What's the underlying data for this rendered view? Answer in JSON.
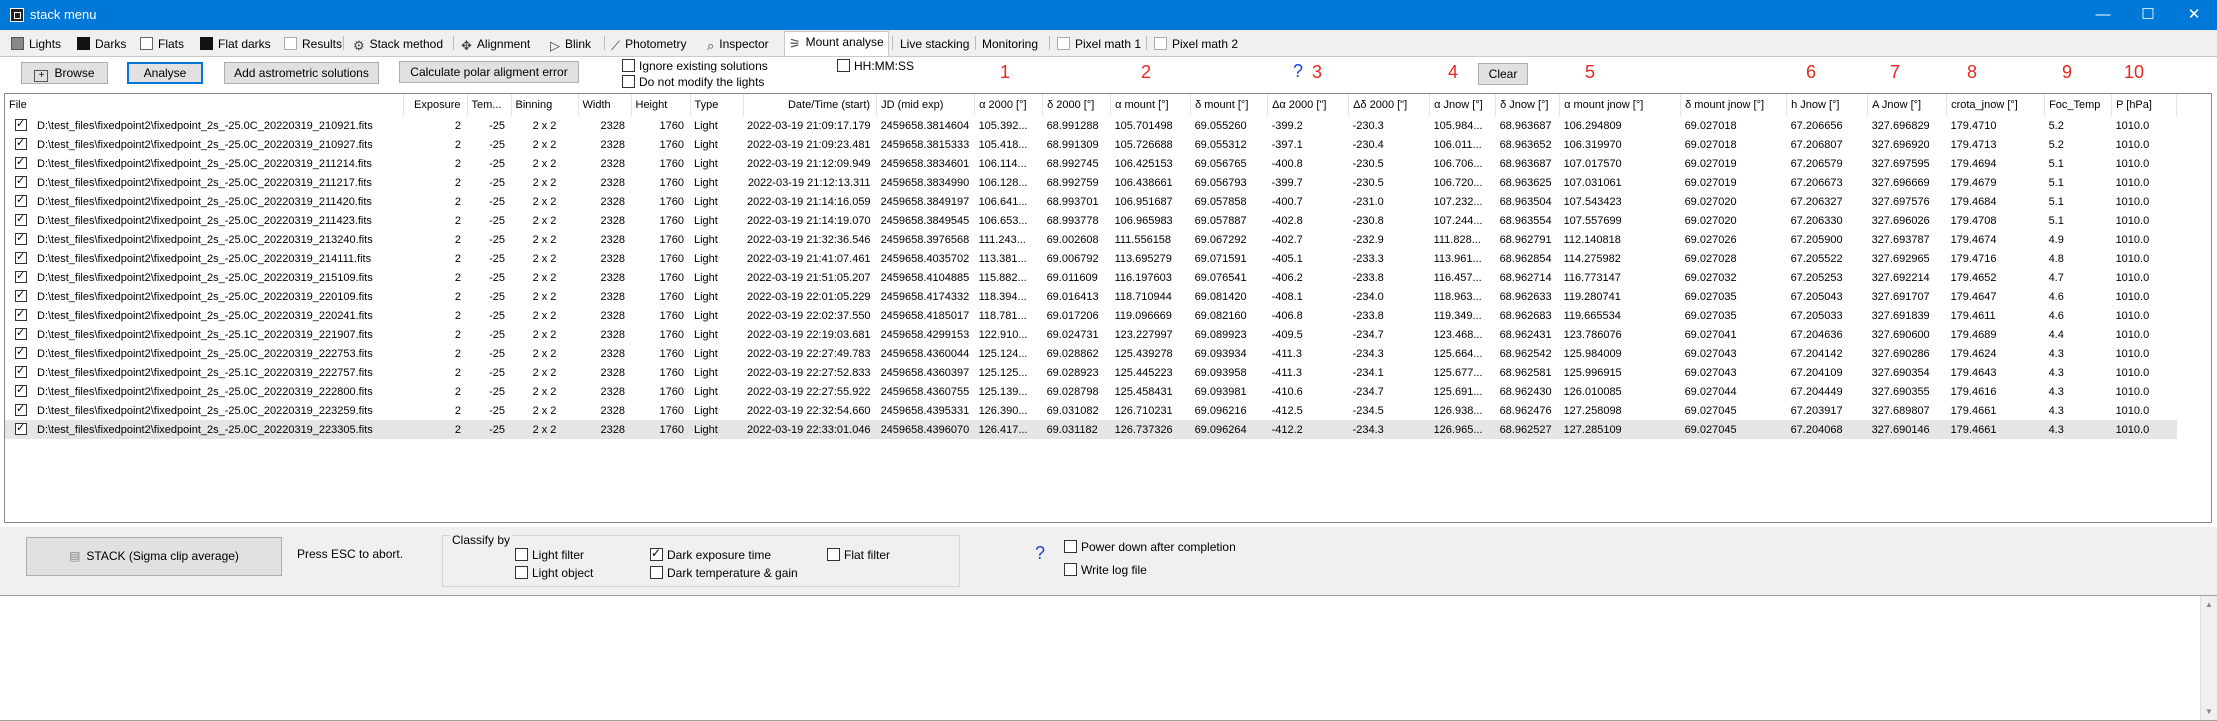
{
  "window": {
    "title": "stack menu",
    "minimize": "—",
    "maximize": "☐",
    "close": "✕"
  },
  "tabs": [
    {
      "label": "Lights",
      "icon": "lights-icon"
    },
    {
      "label": "Darks",
      "icon": "darks-icon"
    },
    {
      "label": "Flats",
      "icon": "flats-icon"
    },
    {
      "label": "Flat darks",
      "icon": "flat-darks-icon"
    },
    {
      "label": "Results",
      "icon": "results-icon"
    },
    {
      "label": "Stack method",
      "icon": "stack-method-icon"
    },
    {
      "label": "Alignment",
      "icon": "alignment-icon"
    },
    {
      "label": "Blink",
      "icon": "blink-icon"
    },
    {
      "label": "Photometry",
      "icon": "photometry-icon"
    },
    {
      "label": "Inspector",
      "icon": "inspector-icon"
    },
    {
      "label": "Mount analyse",
      "icon": "mount-analyse-icon"
    },
    {
      "label": "Live stacking",
      "icon": ""
    },
    {
      "label": "Monitoring",
      "icon": ""
    },
    {
      "label": "Pixel math 1",
      "icon": "pixel-math-icon"
    },
    {
      "label": "Pixel math 2",
      "icon": "pixel-math-icon"
    }
  ],
  "toolbar": {
    "browse": "Browse",
    "analyse": "Analyse",
    "add_astrometric": "Add astrometric solutions",
    "calc_polar": "Calculate polar aligment error",
    "ignore_existing": "Ignore existing solutions",
    "do_not_modify": "Do not modify the lights",
    "hhmmss": "HH:MM:SS",
    "clear": "Clear",
    "help_q": "?"
  },
  "annotations": [
    "1",
    "2",
    "3",
    "4",
    "5",
    "6",
    "7",
    "8",
    "9",
    "10"
  ],
  "table": {
    "headers": [
      "File",
      "Exposure",
      "Tem...",
      "Binning",
      "Width",
      "Height",
      "Type",
      "Date/Time (start)",
      "JD (mid exp)",
      "α 2000 [°]",
      "δ 2000 [°]",
      "α mount [°]",
      "δ mount [°]",
      "Δα 2000 [\"]",
      "Δδ 2000 [\"]",
      "α Jnow [°]",
      "δ Jnow [°]",
      "α mount jnow [°]",
      "δ mount jnow [°]",
      "h Jnow [°]",
      "A Jnow [°]",
      "crota_jnow [°]",
      "Foc_Temp",
      "P [hPa]"
    ],
    "rows": [
      [
        "D:\\test_files\\fixedpoint2\\fixedpoint_2s_-25.0C_20220319_210921.fits",
        "2",
        "-25",
        "2 x 2",
        "2328",
        "1760",
        "Light",
        "2022-03-19 21:09:17.179",
        "2459658.3814604",
        "105.392...",
        "68.991288",
        "105.701498",
        "69.055260",
        "-399.2",
        "-230.3",
        "105.984...",
        "68.963687",
        "106.294809",
        "69.027018",
        "67.206656",
        "327.696829",
        "179.4710",
        "5.2",
        "1010.0"
      ],
      [
        "D:\\test_files\\fixedpoint2\\fixedpoint_2s_-25.0C_20220319_210927.fits",
        "2",
        "-25",
        "2 x 2",
        "2328",
        "1760",
        "Light",
        "2022-03-19 21:09:23.481",
        "2459658.3815333",
        "105.418...",
        "68.991309",
        "105.726688",
        "69.055312",
        "-397.1",
        "-230.4",
        "106.011...",
        "68.963652",
        "106.319970",
        "69.027018",
        "67.206807",
        "327.696920",
        "179.4713",
        "5.2",
        "1010.0"
      ],
      [
        "D:\\test_files\\fixedpoint2\\fixedpoint_2s_-25.0C_20220319_211214.fits",
        "2",
        "-25",
        "2 x 2",
        "2328",
        "1760",
        "Light",
        "2022-03-19 21:12:09.949",
        "2459658.3834601",
        "106.114...",
        "68.992745",
        "106.425153",
        "69.056765",
        "-400.8",
        "-230.5",
        "106.706...",
        "68.963687",
        "107.017570",
        "69.027019",
        "67.206579",
        "327.697595",
        "179.4694",
        "5.1",
        "1010.0"
      ],
      [
        "D:\\test_files\\fixedpoint2\\fixedpoint_2s_-25.0C_20220319_211217.fits",
        "2",
        "-25",
        "2 x 2",
        "2328",
        "1760",
        "Light",
        "2022-03-19 21:12:13.311",
        "2459658.3834990",
        "106.128...",
        "68.992759",
        "106.438661",
        "69.056793",
        "-399.7",
        "-230.5",
        "106.720...",
        "68.963625",
        "107.031061",
        "69.027019",
        "67.206673",
        "327.696669",
        "179.4679",
        "5.1",
        "1010.0"
      ],
      [
        "D:\\test_files\\fixedpoint2\\fixedpoint_2s_-25.0C_20220319_211420.fits",
        "2",
        "-25",
        "2 x 2",
        "2328",
        "1760",
        "Light",
        "2022-03-19 21:14:16.059",
        "2459658.3849197",
        "106.641...",
        "68.993701",
        "106.951687",
        "69.057858",
        "-400.7",
        "-231.0",
        "107.232...",
        "68.963504",
        "107.543423",
        "69.027020",
        "67.206327",
        "327.697576",
        "179.4684",
        "5.1",
        "1010.0"
      ],
      [
        "D:\\test_files\\fixedpoint2\\fixedpoint_2s_-25.0C_20220319_211423.fits",
        "2",
        "-25",
        "2 x 2",
        "2328",
        "1760",
        "Light",
        "2022-03-19 21:14:19.070",
        "2459658.3849545",
        "106.653...",
        "68.993778",
        "106.965983",
        "69.057887",
        "-402.8",
        "-230.8",
        "107.244...",
        "68.963554",
        "107.557699",
        "69.027020",
        "67.206330",
        "327.696026",
        "179.4708",
        "5.1",
        "1010.0"
      ],
      [
        "D:\\test_files\\fixedpoint2\\fixedpoint_2s_-25.0C_20220319_213240.fits",
        "2",
        "-25",
        "2 x 2",
        "2328",
        "1760",
        "Light",
        "2022-03-19 21:32:36.546",
        "2459658.3976568",
        "111.243...",
        "69.002608",
        "111.556158",
        "69.067292",
        "-402.7",
        "-232.9",
        "111.828...",
        "68.962791",
        "112.140818",
        "69.027026",
        "67.205900",
        "327.693787",
        "179.4674",
        "4.9",
        "1010.0"
      ],
      [
        "D:\\test_files\\fixedpoint2\\fixedpoint_2s_-25.0C_20220319_214111.fits",
        "2",
        "-25",
        "2 x 2",
        "2328",
        "1760",
        "Light",
        "2022-03-19 21:41:07.461",
        "2459658.4035702",
        "113.381...",
        "69.006792",
        "113.695279",
        "69.071591",
        "-405.1",
        "-233.3",
        "113.961...",
        "68.962854",
        "114.275982",
        "69.027028",
        "67.205522",
        "327.692965",
        "179.4716",
        "4.8",
        "1010.0"
      ],
      [
        "D:\\test_files\\fixedpoint2\\fixedpoint_2s_-25.0C_20220319_215109.fits",
        "2",
        "-25",
        "2 x 2",
        "2328",
        "1760",
        "Light",
        "2022-03-19 21:51:05.207",
        "2459658.4104885",
        "115.882...",
        "69.011609",
        "116.197603",
        "69.076541",
        "-406.2",
        "-233.8",
        "116.457...",
        "68.962714",
        "116.773147",
        "69.027032",
        "67.205253",
        "327.692214",
        "179.4652",
        "4.7",
        "1010.0"
      ],
      [
        "D:\\test_files\\fixedpoint2\\fixedpoint_2s_-25.0C_20220319_220109.fits",
        "2",
        "-25",
        "2 x 2",
        "2328",
        "1760",
        "Light",
        "2022-03-19 22:01:05.229",
        "2459658.4174332",
        "118.394...",
        "69.016413",
        "118.710944",
        "69.081420",
        "-408.1",
        "-234.0",
        "118.963...",
        "68.962633",
        "119.280741",
        "69.027035",
        "67.205043",
        "327.691707",
        "179.4647",
        "4.6",
        "1010.0"
      ],
      [
        "D:\\test_files\\fixedpoint2\\fixedpoint_2s_-25.0C_20220319_220241.fits",
        "2",
        "-25",
        "2 x 2",
        "2328",
        "1760",
        "Light",
        "2022-03-19 22:02:37.550",
        "2459658.4185017",
        "118.781...",
        "69.017206",
        "119.096669",
        "69.082160",
        "-406.8",
        "-233.8",
        "119.349...",
        "68.962683",
        "119.665534",
        "69.027035",
        "67.205033",
        "327.691839",
        "179.4611",
        "4.6",
        "1010.0"
      ],
      [
        "D:\\test_files\\fixedpoint2\\fixedpoint_2s_-25.1C_20220319_221907.fits",
        "2",
        "-25",
        "2 x 2",
        "2328",
        "1760",
        "Light",
        "2022-03-19 22:19:03.681",
        "2459658.4299153",
        "122.910...",
        "69.024731",
        "123.227997",
        "69.089923",
        "-409.5",
        "-234.7",
        "123.468...",
        "68.962431",
        "123.786076",
        "69.027041",
        "67.204636",
        "327.690600",
        "179.4689",
        "4.4",
        "1010.0"
      ],
      [
        "D:\\test_files\\fixedpoint2\\fixedpoint_2s_-25.0C_20220319_222753.fits",
        "2",
        "-25",
        "2 x 2",
        "2328",
        "1760",
        "Light",
        "2022-03-19 22:27:49.783",
        "2459658.4360044",
        "125.124...",
        "69.028862",
        "125.439278",
        "69.093934",
        "-411.3",
        "-234.3",
        "125.664...",
        "68.962542",
        "125.984009",
        "69.027043",
        "67.204142",
        "327.690286",
        "179.4624",
        "4.3",
        "1010.0"
      ],
      [
        "D:\\test_files\\fixedpoint2\\fixedpoint_2s_-25.1C_20220319_222757.fits",
        "2",
        "-25",
        "2 x 2",
        "2328",
        "1760",
        "Light",
        "2022-03-19 22:27:52.833",
        "2459658.4360397",
        "125.125...",
        "69.028923",
        "125.445223",
        "69.093958",
        "-411.3",
        "-234.1",
        "125.677...",
        "68.962581",
        "125.996915",
        "69.027043",
        "67.204109",
        "327.690354",
        "179.4643",
        "4.3",
        "1010.0"
      ],
      [
        "D:\\test_files\\fixedpoint2\\fixedpoint_2s_-25.0C_20220319_222800.fits",
        "2",
        "-25",
        "2 x 2",
        "2328",
        "1760",
        "Light",
        "2022-03-19 22:27:55.922",
        "2459658.4360755",
        "125.139...",
        "69.028798",
        "125.458431",
        "69.093981",
        "-410.6",
        "-234.7",
        "125.691...",
        "68.962430",
        "126.010085",
        "69.027044",
        "67.204449",
        "327.690355",
        "179.4616",
        "4.3",
        "1010.0"
      ],
      [
        "D:\\test_files\\fixedpoint2\\fixedpoint_2s_-25.0C_20220319_223259.fits",
        "2",
        "-25",
        "2 x 2",
        "2328",
        "1760",
        "Light",
        "2022-03-19 22:32:54.660",
        "2459658.4395331",
        "126.390...",
        "69.031082",
        "126.710231",
        "69.096216",
        "-412.5",
        "-234.5",
        "126.938...",
        "68.962476",
        "127.258098",
        "69.027045",
        "67.203917",
        "327.689807",
        "179.4661",
        "4.3",
        "1010.0"
      ],
      [
        "D:\\test_files\\fixedpoint2\\fixedpoint_2s_-25.0C_20220319_223305.fits",
        "2",
        "-25",
        "2 x 2",
        "2328",
        "1760",
        "Light",
        "2022-03-19 22:33:01.046",
        "2459658.4396070",
        "126.417...",
        "69.031182",
        "126.737326",
        "69.096264",
        "-412.2",
        "-234.3",
        "126.965...",
        "68.962527",
        "127.285109",
        "69.027045",
        "67.204068",
        "327.690146",
        "179.4661",
        "4.3",
        "1010.0"
      ]
    ]
  },
  "bottom": {
    "stack_button": "STACK  (Sigma clip average)",
    "esc_text": "Press ESC to abort.",
    "classify_title": "Classify by",
    "light_filter": "Light filter",
    "light_object": "Light object",
    "dark_exposure": "Dark exposure time",
    "dark_temperature": "Dark temperature & gain",
    "flat_filter": "Flat filter",
    "help_q": "?",
    "power_down": "Power down after completion",
    "write_log": "Write log file"
  }
}
